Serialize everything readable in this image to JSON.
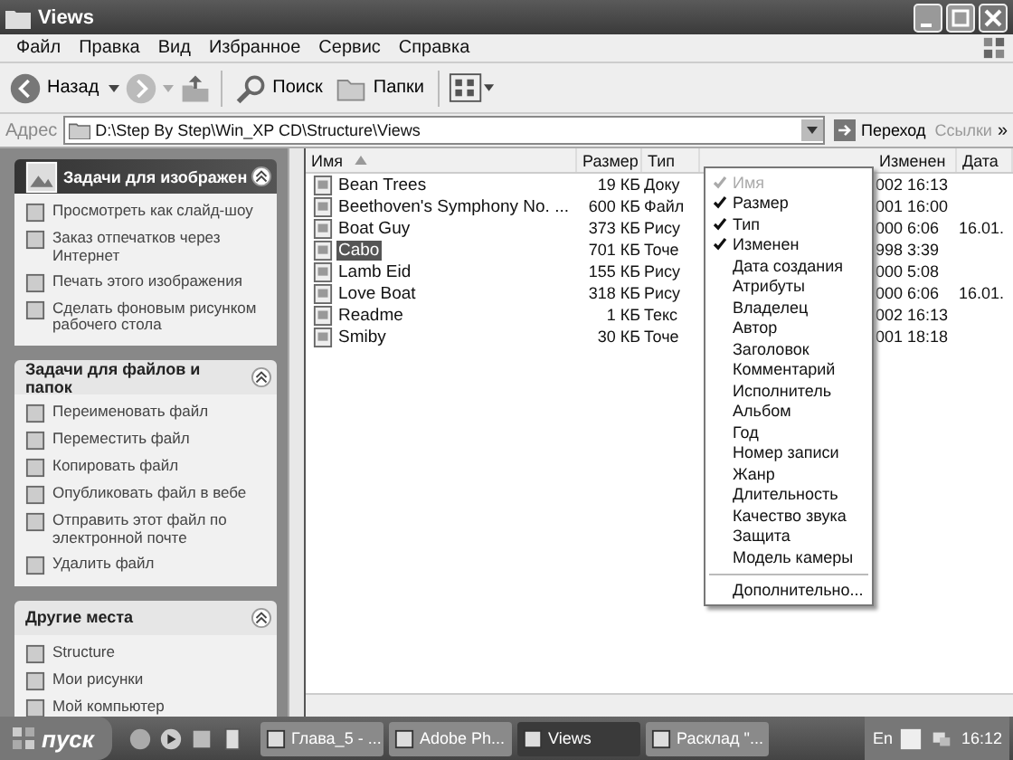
{
  "window": {
    "title": "Views"
  },
  "menu": [
    "Файл",
    "Правка",
    "Вид",
    "Избранное",
    "Сервис",
    "Справка"
  ],
  "toolbar": {
    "back": "Назад",
    "search": "Поиск",
    "folders": "Папки"
  },
  "address": {
    "label": "Адрес",
    "value": "D:\\Step By Step\\Win_XP CD\\Structure\\Views",
    "go": "Переход",
    "links": "Ссылки",
    "more": "»"
  },
  "sidebar": {
    "sections": [
      {
        "title": "Задачи для изображен",
        "highlight": true,
        "items": [
          "Просмотреть как слайд-шоу",
          "Заказ отпечатков через Интернет",
          "Печать этого изображения",
          "Сделать фоновым рисунком рабочего стола"
        ]
      },
      {
        "title": "Задачи для файлов и папок",
        "highlight": false,
        "items": [
          "Переименовать файл",
          "Переместить файл",
          "Копировать файл",
          "Опубликовать файл в вебе",
          "Отправить этот файл по электронной почте",
          "Удалить файл"
        ]
      },
      {
        "title": "Другие места",
        "highlight": false,
        "items": [
          "Structure",
          "Мои рисунки",
          "Мой компьютер"
        ]
      }
    ]
  },
  "table": {
    "columns": [
      "Имя",
      "Размер",
      "Тип",
      "Изменен",
      "Дата"
    ],
    "rows": [
      {
        "name": "Bean Trees",
        "size": "19 КБ",
        "type": "Доку",
        "modified": "002 16:13",
        "selected": false
      },
      {
        "name": "Beethoven's Symphony No. ...",
        "size": "600 КБ",
        "type": "Файл",
        "modified": "001 16:00",
        "selected": false
      },
      {
        "name": "Boat Guy",
        "size": "373 КБ",
        "type": "Рису",
        "modified": "000 6:06",
        "column_5": "16.01.",
        "selected": false
      },
      {
        "name": "Cabo",
        "size": "701 КБ",
        "type": "Точе",
        "modified": "998 3:39",
        "selected": true
      },
      {
        "name": "Lamb Eid",
        "size": "155 КБ",
        "type": "Рису",
        "modified": "000 5:08",
        "selected": false
      },
      {
        "name": "Love Boat",
        "size": "318 КБ",
        "type": "Рису",
        "modified": "000 6:06",
        "column_5": "16.01.",
        "selected": false
      },
      {
        "name": "Readme",
        "size": "1 КБ",
        "type": "Текс",
        "modified": "002 16:13",
        "selected": false
      },
      {
        "name": "Smiby",
        "size": "30 КБ",
        "type": "Точе",
        "modified": "001 18:18",
        "selected": false
      }
    ]
  },
  "context_menu": {
    "items": [
      {
        "label": "Имя",
        "checked": true,
        "disabled": true
      },
      {
        "label": "Размер",
        "checked": true,
        "disabled": false
      },
      {
        "label": "Тип",
        "checked": true,
        "disabled": false
      },
      {
        "label": "Изменен",
        "checked": true,
        "disabled": false
      },
      {
        "label": "Дата создания",
        "checked": false,
        "disabled": false
      },
      {
        "label": "Атрибуты",
        "checked": false,
        "disabled": false
      },
      {
        "label": "Владелец",
        "checked": false,
        "disabled": false
      },
      {
        "label": "Автор",
        "checked": false,
        "disabled": false
      },
      {
        "label": "Заголовок",
        "checked": false,
        "disabled": false
      },
      {
        "label": "Комментарий",
        "checked": false,
        "disabled": false
      },
      {
        "label": "Исполнитель",
        "checked": false,
        "disabled": false
      },
      {
        "label": "Альбом",
        "checked": false,
        "disabled": false
      },
      {
        "label": "Год",
        "checked": false,
        "disabled": false
      },
      {
        "label": "Номер записи",
        "checked": false,
        "disabled": false
      },
      {
        "label": "Жанр",
        "checked": false,
        "disabled": false
      },
      {
        "label": "Длительность",
        "checked": false,
        "disabled": false
      },
      {
        "label": "Качество звука",
        "checked": false,
        "disabled": false
      },
      {
        "label": "Защита",
        "checked": false,
        "disabled": false
      },
      {
        "label": "Модель камеры",
        "checked": false,
        "disabled": false
      }
    ],
    "more": "Дополнительно..."
  },
  "taskbar": {
    "start": "пуск",
    "tasks": [
      {
        "label": "Глава_5 - ...",
        "selected": false
      },
      {
        "label": "Adobe Ph...",
        "selected": false
      },
      {
        "label": "Views",
        "selected": true
      },
      {
        "label": "Расклад \"...",
        "selected": false
      }
    ],
    "language": "En",
    "clock": "16:12"
  }
}
